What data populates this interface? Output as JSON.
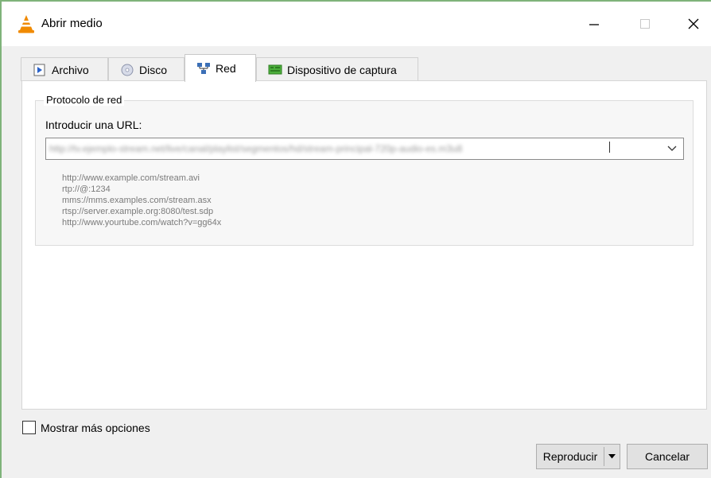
{
  "window": {
    "title": "Abrir medio"
  },
  "tabs": [
    {
      "label": "Archivo",
      "icon": "file-icon"
    },
    {
      "label": "Disco",
      "icon": "disc-icon"
    },
    {
      "label": "Red",
      "icon": "network-icon"
    },
    {
      "label": "Dispositivo de captura",
      "icon": "capture-device-icon"
    }
  ],
  "active_tab": "Red",
  "network": {
    "group_title": "Protocolo de red",
    "url_label": "Introducir una URL:",
    "url_value": "http://tv.ejemplo-stream.net/live/canal/playlist/segmentos/hd/stream-principal-720p-audio-es.m3u8",
    "examples": [
      "http://www.example.com/stream.avi",
      "rtp://@:1234",
      "mms://mms.examples.com/stream.asx",
      "rtsp://server.example.org:8080/test.sdp",
      "http://www.yourtube.com/watch?v=gg64x"
    ]
  },
  "footer": {
    "more_options_label": "Mostrar más opciones",
    "more_options_checked": false,
    "play_label": "Reproducir",
    "cancel_label": "Cancelar"
  },
  "colors": {
    "vlc_orange": "#f08a00",
    "frame_green": "#7fb37a"
  }
}
